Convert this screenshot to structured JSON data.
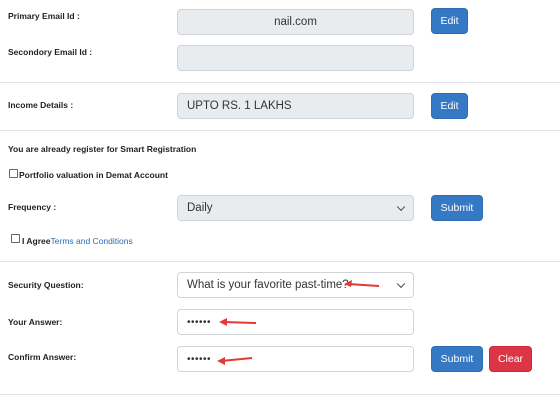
{
  "primary_email": {
    "label": "Primary Email Id :",
    "value": "nail.com",
    "button": "Edit"
  },
  "secondary_email": {
    "label": "Secondory Email Id :",
    "value": ""
  },
  "income": {
    "label": "Income Details :",
    "value": "UPTO RS. 1 LAKHS",
    "button": "Edit"
  },
  "smart_registration": {
    "notice": "You are already register for Smart Registration",
    "portfolio_checkbox_label": "Portfolio valuation in Demat Account",
    "portfolio_checked": false,
    "frequency_label": "Frequency :",
    "frequency_value": "Daily",
    "submit_button": "Submit",
    "agree_text": "I Agree",
    "terms_link": "Terms and Conditions",
    "agree_checked": false
  },
  "security": {
    "question_label": "Security Question:",
    "question_value": "What is your favorite past-time?",
    "answer_label": "Your Answer:",
    "answer_value": "••••••",
    "confirm_label": "Confirm Answer:",
    "confirm_value": "••••••",
    "submit_button": "Submit",
    "clear_button": "Clear"
  },
  "annotation_arrow_color": "#e53935"
}
